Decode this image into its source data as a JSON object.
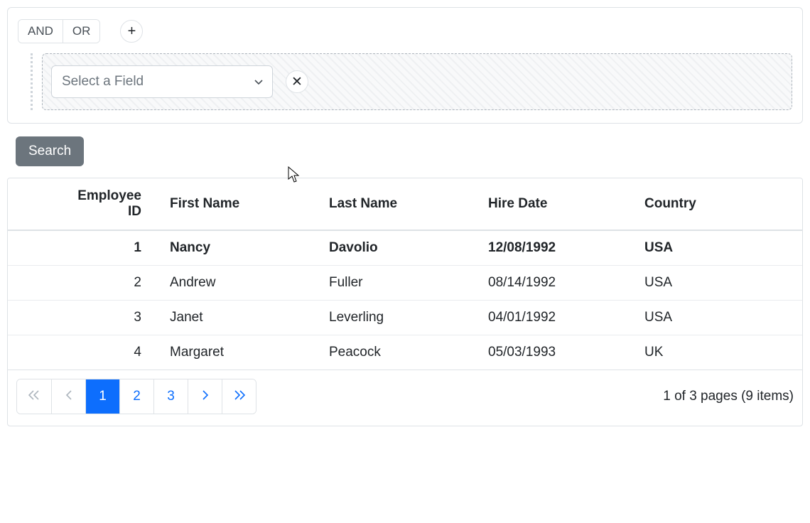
{
  "filter": {
    "logic": {
      "and": "AND",
      "or": "OR"
    },
    "add_label": "+",
    "field_select_placeholder": "Select a Field",
    "remove_label": "✕"
  },
  "search": {
    "label": "Search"
  },
  "columns": {
    "employee_id": "Employee ID",
    "first_name": "First Name",
    "last_name": "Last Name",
    "hire_date": "Hire Date",
    "country": "Country"
  },
  "rows": [
    {
      "id": "1",
      "first_name": "Nancy",
      "last_name": "Davolio",
      "hire_date": "12/08/1992",
      "country": "USA"
    },
    {
      "id": "2",
      "first_name": "Andrew",
      "last_name": "Fuller",
      "hire_date": "08/14/1992",
      "country": "USA"
    },
    {
      "id": "3",
      "first_name": "Janet",
      "last_name": "Leverling",
      "hire_date": "04/01/1992",
      "country": "USA"
    },
    {
      "id": "4",
      "first_name": "Margaret",
      "last_name": "Peacock",
      "hire_date": "05/03/1993",
      "country": "UK"
    }
  ],
  "pager": {
    "pages": [
      "1",
      "2",
      "3"
    ],
    "current": "1",
    "summary": "1 of 3 pages (9 items)"
  }
}
